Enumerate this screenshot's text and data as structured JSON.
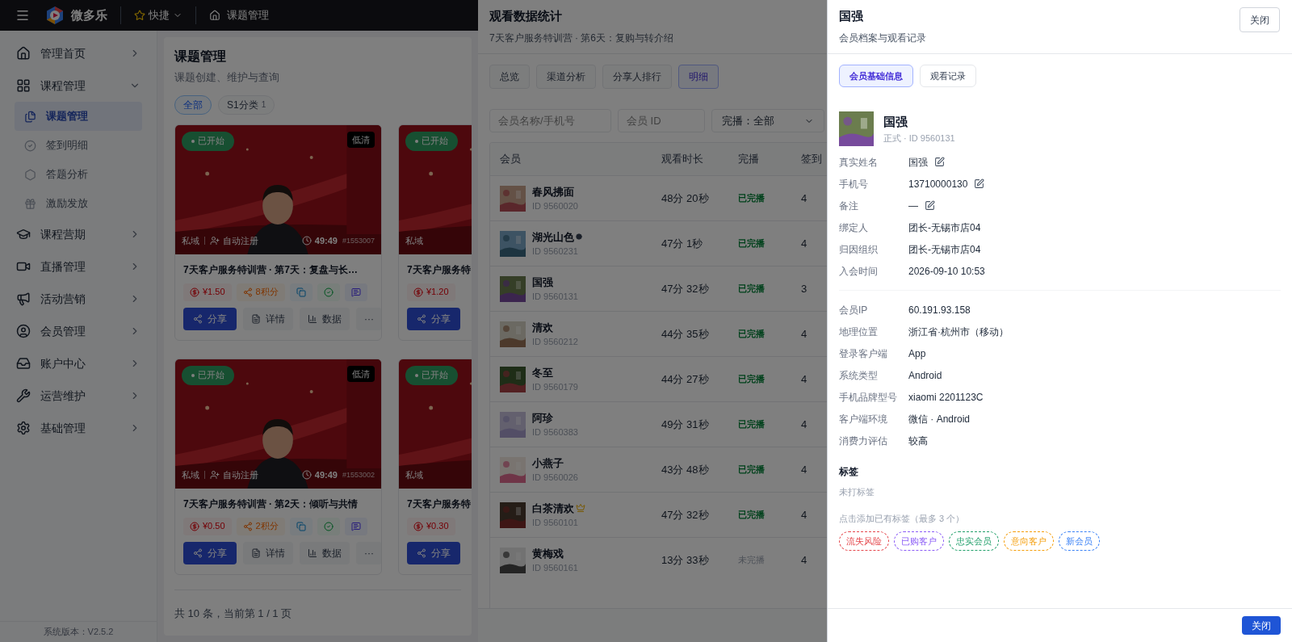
{
  "top_bar": {
    "app_name": "微多乐",
    "quick": "快捷",
    "breadcrumb": "课题管理"
  },
  "sidebar": {
    "items": [
      {
        "label": "管理首页",
        "selected": false,
        "expanded": false
      },
      {
        "label": "课程管理",
        "selected": false,
        "expanded": true,
        "children": [
          {
            "label": "课题管理",
            "selected": true
          },
          {
            "label": "签到明细",
            "selected": false
          },
          {
            "label": "答题分析",
            "selected": false
          },
          {
            "label": "激励发放",
            "selected": false
          }
        ]
      },
      {
        "label": "课程营期",
        "selected": false,
        "expanded": false
      },
      {
        "label": "直播管理",
        "selected": false,
        "expanded": false
      },
      {
        "label": "活动营销",
        "selected": false,
        "expanded": false
      },
      {
        "label": "会员管理",
        "selected": false,
        "expanded": false
      },
      {
        "label": "账户中心",
        "selected": false,
        "expanded": false
      },
      {
        "label": "运营维护",
        "selected": false,
        "expanded": false
      },
      {
        "label": "基础管理",
        "selected": false,
        "expanded": false
      }
    ],
    "version": "系统版本：V2.5.2"
  },
  "page": {
    "title": "课题管理",
    "subtitle": "课题创建、维护与查询",
    "filters": [
      {
        "label": "全部",
        "selected": true
      },
      {
        "label": "S1分类",
        "count": "1",
        "selected": false
      }
    ],
    "cards": [
      {
        "status": "已开始",
        "quality": "低清",
        "channel": "私域",
        "registration": "自动注册",
        "duration": "49:49",
        "code": "#1553007",
        "title": "7天客户服务特训营 · 第7天：复盘与长…",
        "price": "¥1.50",
        "points": "8积分",
        "actions": [
          "分享",
          "详情",
          "数据",
          "···"
        ]
      },
      {
        "status": "已开始",
        "channel": "私域",
        "title": "7天客户服务特",
        "price": "¥1.20",
        "actions": [
          "分享"
        ]
      },
      {
        "status": "已开始",
        "quality": "低清",
        "channel": "私域",
        "registration": "自动注册",
        "duration": "49:49",
        "code": "#1553002",
        "title": "7天客户服务特训营 · 第2天：倾听与共情",
        "price": "¥0.50",
        "points": "2积分",
        "actions": [
          "分享",
          "详情",
          "数据",
          "···"
        ]
      },
      {
        "status": "已开始",
        "channel": "私域",
        "title": "7天客户服务特",
        "price": "¥0.30",
        "actions": [
          "分享"
        ]
      }
    ],
    "pagination": "共 10 条，当前第 1 / 1 页"
  },
  "stats_drawer": {
    "title": "观看数据统计",
    "subtitle": "7天客户服务特训营 · 第6天：复购与转介绍",
    "tabs": [
      {
        "label": "总览",
        "selected": false
      },
      {
        "label": "渠道分析",
        "selected": false
      },
      {
        "label": "分享人排行",
        "selected": false
      },
      {
        "label": "明细",
        "selected": true
      }
    ],
    "search": {
      "placeholder": "会员名称/手机号"
    },
    "id_search": {
      "placeholder": "会员 ID"
    },
    "completion_filter": "完播：全部",
    "columns": [
      "会员",
      "观看时长",
      "完播",
      "签到"
    ],
    "rows": [
      {
        "name": "春风拂面",
        "id": "ID 9560020",
        "duration": "48分 20秒",
        "completion": "已完播",
        "finished": true,
        "checkins": "4"
      },
      {
        "name": "湖光山色",
        "kind": "dot",
        "id": "ID 9560231",
        "duration": "47分 1秒",
        "completion": "已完播",
        "finished": true,
        "checkins": "4"
      },
      {
        "name": "国强",
        "id": "ID 9560131",
        "duration": "47分 32秒",
        "completion": "已完播",
        "finished": true,
        "checkins": "3"
      },
      {
        "name": "清欢",
        "id": "ID 9560212",
        "duration": "44分 35秒",
        "completion": "已完播",
        "finished": true,
        "checkins": "4"
      },
      {
        "name": "冬至",
        "id": "ID 9560179",
        "duration": "44分 27秒",
        "completion": "已完播",
        "finished": true,
        "checkins": "4"
      },
      {
        "name": "阿珍",
        "id": "ID 9560383",
        "duration": "49分 31秒",
        "completion": "已完播",
        "finished": true,
        "checkins": "4"
      },
      {
        "name": "小燕子",
        "id": "ID 9560026",
        "duration": "43分 48秒",
        "completion": "已完播",
        "finished": true,
        "checkins": "4"
      },
      {
        "name": "白茶清欢",
        "kind": "crown",
        "id": "ID 9560101",
        "duration": "47分 32秒",
        "completion": "已完播",
        "finished": true,
        "checkins": "4"
      },
      {
        "name": "黄梅戏",
        "id": "ID 9560161",
        "duration": "13分 33秒",
        "completion": "未完播",
        "finished": false,
        "checkins": "4"
      }
    ]
  },
  "member_drawer": {
    "title": "国强",
    "subtitle": "会员档案与观看记录",
    "close": "关闭",
    "tabs": [
      {
        "label": "会员基础信息",
        "selected": true
      },
      {
        "label": "观看记录",
        "selected": false
      }
    ],
    "name": "国强",
    "meta": "正式 · ID 9560131",
    "groups": [
      [
        {
          "label": "真实姓名",
          "value": "国强",
          "editable": true
        },
        {
          "label": "手机号",
          "value": "13710000130",
          "editable": true
        },
        {
          "label": "备注",
          "value": "—",
          "editable": true
        },
        {
          "label": "绑定人",
          "value": "团长-无锡市店04",
          "editable": false
        },
        {
          "label": "归因组织",
          "value": "团长-无锡市店04",
          "editable": false
        },
        {
          "label": "入会时间",
          "value": "2026-09-10 10:53",
          "editable": false
        }
      ],
      [
        {
          "label": "会员IP",
          "value": "60.191.93.158",
          "editable": false
        },
        {
          "label": "地理位置",
          "value": "浙江省·杭州市（移动）",
          "editable": false
        },
        {
          "label": "登录客户端",
          "value": "App",
          "editable": false
        },
        {
          "label": "系统类型",
          "value": "Android",
          "editable": false
        },
        {
          "label": "手机品牌型号",
          "value": "xiaomi 2201123C",
          "editable": false
        },
        {
          "label": "客户端环境",
          "value": "微信 · Android",
          "editable": false
        },
        {
          "label": "消费力评估",
          "value": "较高",
          "editable": false
        }
      ]
    ],
    "tags_title": "标签",
    "tags_empty": "未打标签",
    "tags_hint": "点击添加已有标签（最多 3 个）",
    "tags": [
      {
        "label": "流失风险",
        "color": "#e5484d"
      },
      {
        "label": "已购客户",
        "color": "#8b5cf6"
      },
      {
        "label": "忠实会员",
        "color": "#22a06b"
      },
      {
        "label": "意向客户",
        "color": "#f59e0b"
      },
      {
        "label": "新会员",
        "color": "#3b82f6"
      }
    ],
    "footer_close": "关闭"
  }
}
